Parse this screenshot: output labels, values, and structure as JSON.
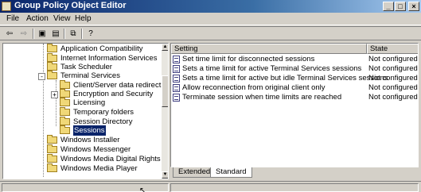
{
  "window": {
    "title": "Group Policy Object Editor"
  },
  "menu": {
    "file": "File",
    "action": "Action",
    "view": "View",
    "help": "Help"
  },
  "tree": {
    "items": [
      {
        "label": "Application Compatibility"
      },
      {
        "label": "Internet Information Services"
      },
      {
        "label": "Task Scheduler"
      },
      {
        "label": "Terminal Services"
      },
      {
        "label": "Client/Server data redirection"
      },
      {
        "label": "Encryption and Security"
      },
      {
        "label": "Licensing"
      },
      {
        "label": "Temporary folders"
      },
      {
        "label": "Session Directory"
      },
      {
        "label": "Sessions"
      },
      {
        "label": "Windows Installer"
      },
      {
        "label": "Windows Messenger"
      },
      {
        "label": "Windows Media Digital Rights Manac"
      },
      {
        "label": "Windows Media Player"
      }
    ]
  },
  "list": {
    "headers": {
      "setting": "Setting",
      "state": "State"
    },
    "rows": [
      {
        "setting": "Set time limit for disconnected sessions",
        "state": "Not configured"
      },
      {
        "setting": "Sets a time limit for active Terminal Services sessions",
        "state": "Not configured"
      },
      {
        "setting": "Sets a time limit for active but idle Terminal Services sessions",
        "state": "Not configured"
      },
      {
        "setting": "Allow reconnection from original client only",
        "state": "Not configured"
      },
      {
        "setting": "Terminate session when time limits are reached",
        "state": "Not configured"
      }
    ]
  },
  "tabs": {
    "extended": "Extended",
    "standard": "Standard"
  },
  "colors": {
    "titlebar": "#0a246a",
    "selection": "#0a246a",
    "folder": "#f0d878"
  }
}
